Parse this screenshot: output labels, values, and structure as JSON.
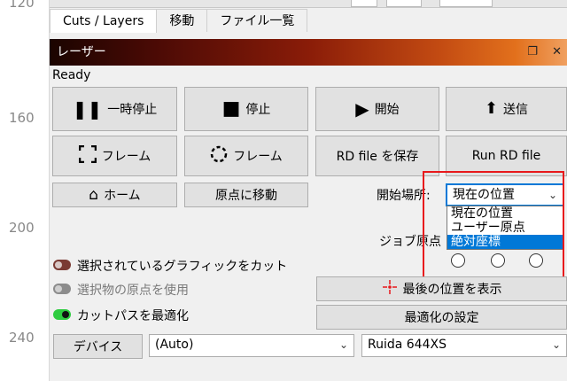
{
  "ruler": {
    "marks": [
      "120",
      "160",
      "200",
      "240"
    ]
  },
  "tabs": [
    {
      "label": "Cuts / Layers"
    },
    {
      "label": "移動"
    },
    {
      "label": "ファイル一覧"
    }
  ],
  "panel": {
    "title": "レーザー",
    "status": "Ready"
  },
  "buttons": {
    "pause": "一時停止",
    "stop": "停止",
    "start": "開始",
    "send": "送信",
    "frame1": "フレーム",
    "frame2": "フレーム",
    "save_rd": "RD file を保存",
    "run_rd": "Run RD file",
    "home": "ホーム",
    "move_origin": "原点に移動",
    "show_last": "最後の位置を表示",
    "optimize_settings": "最適化の設定",
    "device": "デバイス"
  },
  "start_from": {
    "label": "開始場所:",
    "value": "現在の位置",
    "options": [
      "現在の位置",
      "ユーザー原点",
      "絶対座標"
    ],
    "selected_index": 2
  },
  "job_origin": {
    "label": "ジョブ原点"
  },
  "toggles": [
    {
      "label": "選択されているグラフィックをカット",
      "state": "off",
      "color": "#7a3a33"
    },
    {
      "label": "選択物の原点を使用",
      "state": "off-disabled",
      "color": "#8c8c8c"
    },
    {
      "label": "カットパスを最適化",
      "state": "on",
      "color": "#2ecc40"
    }
  ],
  "device_row": {
    "port_value": "(Auto)",
    "model_value": "Ruida 644XS"
  },
  "colors": {
    "highlight": "#e8191c",
    "selection": "#0078d7"
  }
}
